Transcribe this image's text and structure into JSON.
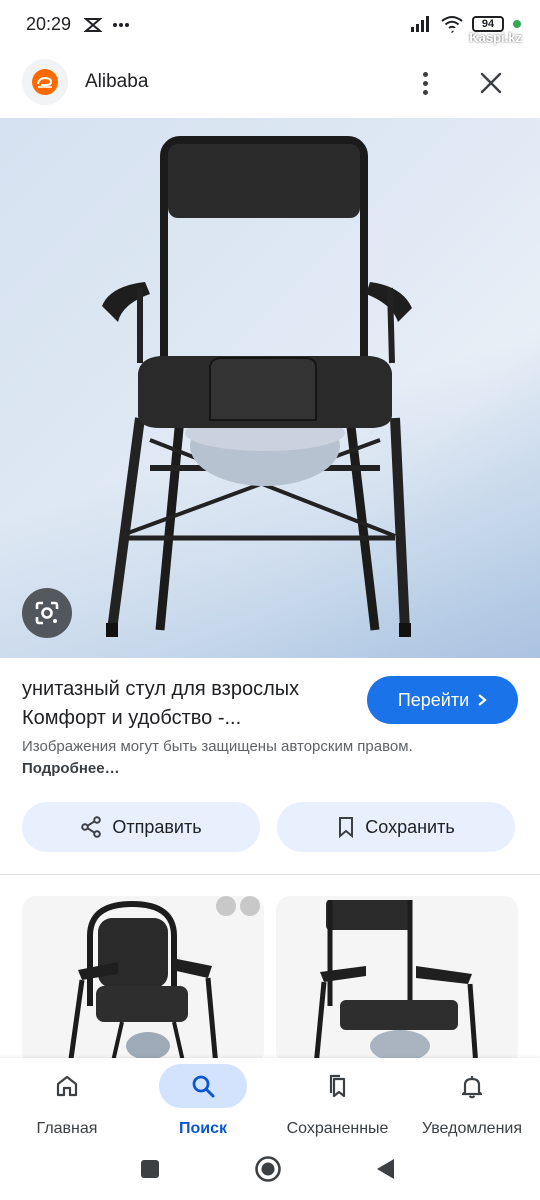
{
  "status_bar": {
    "time": "20:29",
    "battery": "94",
    "watermark": "Kaspi.kz"
  },
  "header": {
    "site_name": "Alibaba"
  },
  "result": {
    "title_line1": "унитазный стул для взрослых",
    "title_line2": "Комфорт и удобство -...",
    "visit_label": "Перейти",
    "copyright_text": "Изображения могут быть защищены авторским правом.",
    "copyright_more": "Подробнее…"
  },
  "actions": {
    "share_label": "Отправить",
    "save_label": "Сохранить"
  },
  "bottom_nav": {
    "items": [
      {
        "label": "Главная",
        "icon": "home-icon",
        "active": false
      },
      {
        "label": "Поиск",
        "icon": "search-icon",
        "active": true
      },
      {
        "label": "Сохраненные",
        "icon": "bookmarks-icon",
        "active": false
      },
      {
        "label": "Уведомления",
        "icon": "bell-icon",
        "active": false
      }
    ]
  },
  "colors": {
    "accent": "#1a73e8",
    "button_bg": "#e8f0fe",
    "active_nav_bg": "#d3e3fd",
    "active_nav_text": "#0b57d0",
    "brand_orange": "#ff6a00"
  }
}
